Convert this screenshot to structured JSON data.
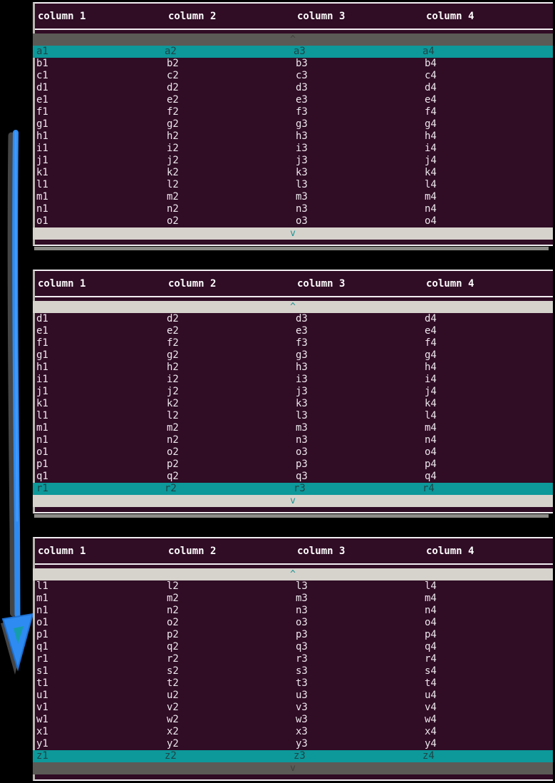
{
  "columns": [
    "column 1",
    "column 2",
    "column 3",
    "column 4"
  ],
  "indicators": {
    "up": "^",
    "down": "v"
  },
  "colors": {
    "page_bg": "#000000",
    "table_bg": "#300c25",
    "header_text": "#ffffff",
    "row_text": "#ece7ec",
    "selected_bg": "#0d989a",
    "selected_text": "#1d4548",
    "indicator_active_bg": "#d6d3cc",
    "indicator_active_text": "#1f9595",
    "indicator_inactive_bg": "#5c5a56",
    "indicator_inactive_text": "#44423e",
    "border": "#f2eef2",
    "arrow": "#2e8bf2"
  },
  "arrow": {
    "direction": "down"
  },
  "tables": [
    {
      "name": "table-1",
      "scroll_up_active": false,
      "scroll_down_active": true,
      "selected_row": 0,
      "rows": [
        [
          "a1",
          "a2",
          "a3",
          "a4"
        ],
        [
          "b1",
          "b2",
          "b3",
          "b4"
        ],
        [
          "c1",
          "c2",
          "c3",
          "c4"
        ],
        [
          "d1",
          "d2",
          "d3",
          "d4"
        ],
        [
          "e1",
          "e2",
          "e3",
          "e4"
        ],
        [
          "f1",
          "f2",
          "f3",
          "f4"
        ],
        [
          "g1",
          "g2",
          "g3",
          "g4"
        ],
        [
          "h1",
          "h2",
          "h3",
          "h4"
        ],
        [
          "i1",
          "i2",
          "i3",
          "i4"
        ],
        [
          "j1",
          "j2",
          "j3",
          "j4"
        ],
        [
          "k1",
          "k2",
          "k3",
          "k4"
        ],
        [
          "l1",
          "l2",
          "l3",
          "l4"
        ],
        [
          "m1",
          "m2",
          "m3",
          "m4"
        ],
        [
          "n1",
          "n2",
          "n3",
          "n4"
        ],
        [
          "o1",
          "o2",
          "o3",
          "o4"
        ]
      ]
    },
    {
      "name": "table-2",
      "scroll_up_active": true,
      "scroll_down_active": true,
      "selected_row": 14,
      "rows": [
        [
          "d1",
          "d2",
          "d3",
          "d4"
        ],
        [
          "e1",
          "e2",
          "e3",
          "e4"
        ],
        [
          "f1",
          "f2",
          "f3",
          "f4"
        ],
        [
          "g1",
          "g2",
          "g3",
          "g4"
        ],
        [
          "h1",
          "h2",
          "h3",
          "h4"
        ],
        [
          "i1",
          "i2",
          "i3",
          "i4"
        ],
        [
          "j1",
          "j2",
          "j3",
          "j4"
        ],
        [
          "k1",
          "k2",
          "k3",
          "k4"
        ],
        [
          "l1",
          "l2",
          "l3",
          "l4"
        ],
        [
          "m1",
          "m2",
          "m3",
          "m4"
        ],
        [
          "n1",
          "n2",
          "n3",
          "n4"
        ],
        [
          "o1",
          "o2",
          "o3",
          "o4"
        ],
        [
          "p1",
          "p2",
          "p3",
          "p4"
        ],
        [
          "q1",
          "q2",
          "q3",
          "q4"
        ],
        [
          "r1",
          "r2",
          "r3",
          "r4"
        ]
      ]
    },
    {
      "name": "table-3",
      "scroll_up_active": true,
      "scroll_down_active": false,
      "selected_row": 14,
      "rows": [
        [
          "l1",
          "l2",
          "l3",
          "l4"
        ],
        [
          "m1",
          "m2",
          "m3",
          "m4"
        ],
        [
          "n1",
          "n2",
          "n3",
          "n4"
        ],
        [
          "o1",
          "o2",
          "o3",
          "o4"
        ],
        [
          "p1",
          "p2",
          "p3",
          "p4"
        ],
        [
          "q1",
          "q2",
          "q3",
          "q4"
        ],
        [
          "r1",
          "r2",
          "r3",
          "r4"
        ],
        [
          "s1",
          "s2",
          "s3",
          "s4"
        ],
        [
          "t1",
          "t2",
          "t3",
          "t4"
        ],
        [
          "u1",
          "u2",
          "u3",
          "u4"
        ],
        [
          "v1",
          "v2",
          "v3",
          "v4"
        ],
        [
          "w1",
          "w2",
          "w3",
          "w4"
        ],
        [
          "x1",
          "x2",
          "x3",
          "x4"
        ],
        [
          "y1",
          "y2",
          "y3",
          "y4"
        ],
        [
          "z1",
          "z2",
          "z3",
          "z4"
        ]
      ]
    }
  ]
}
